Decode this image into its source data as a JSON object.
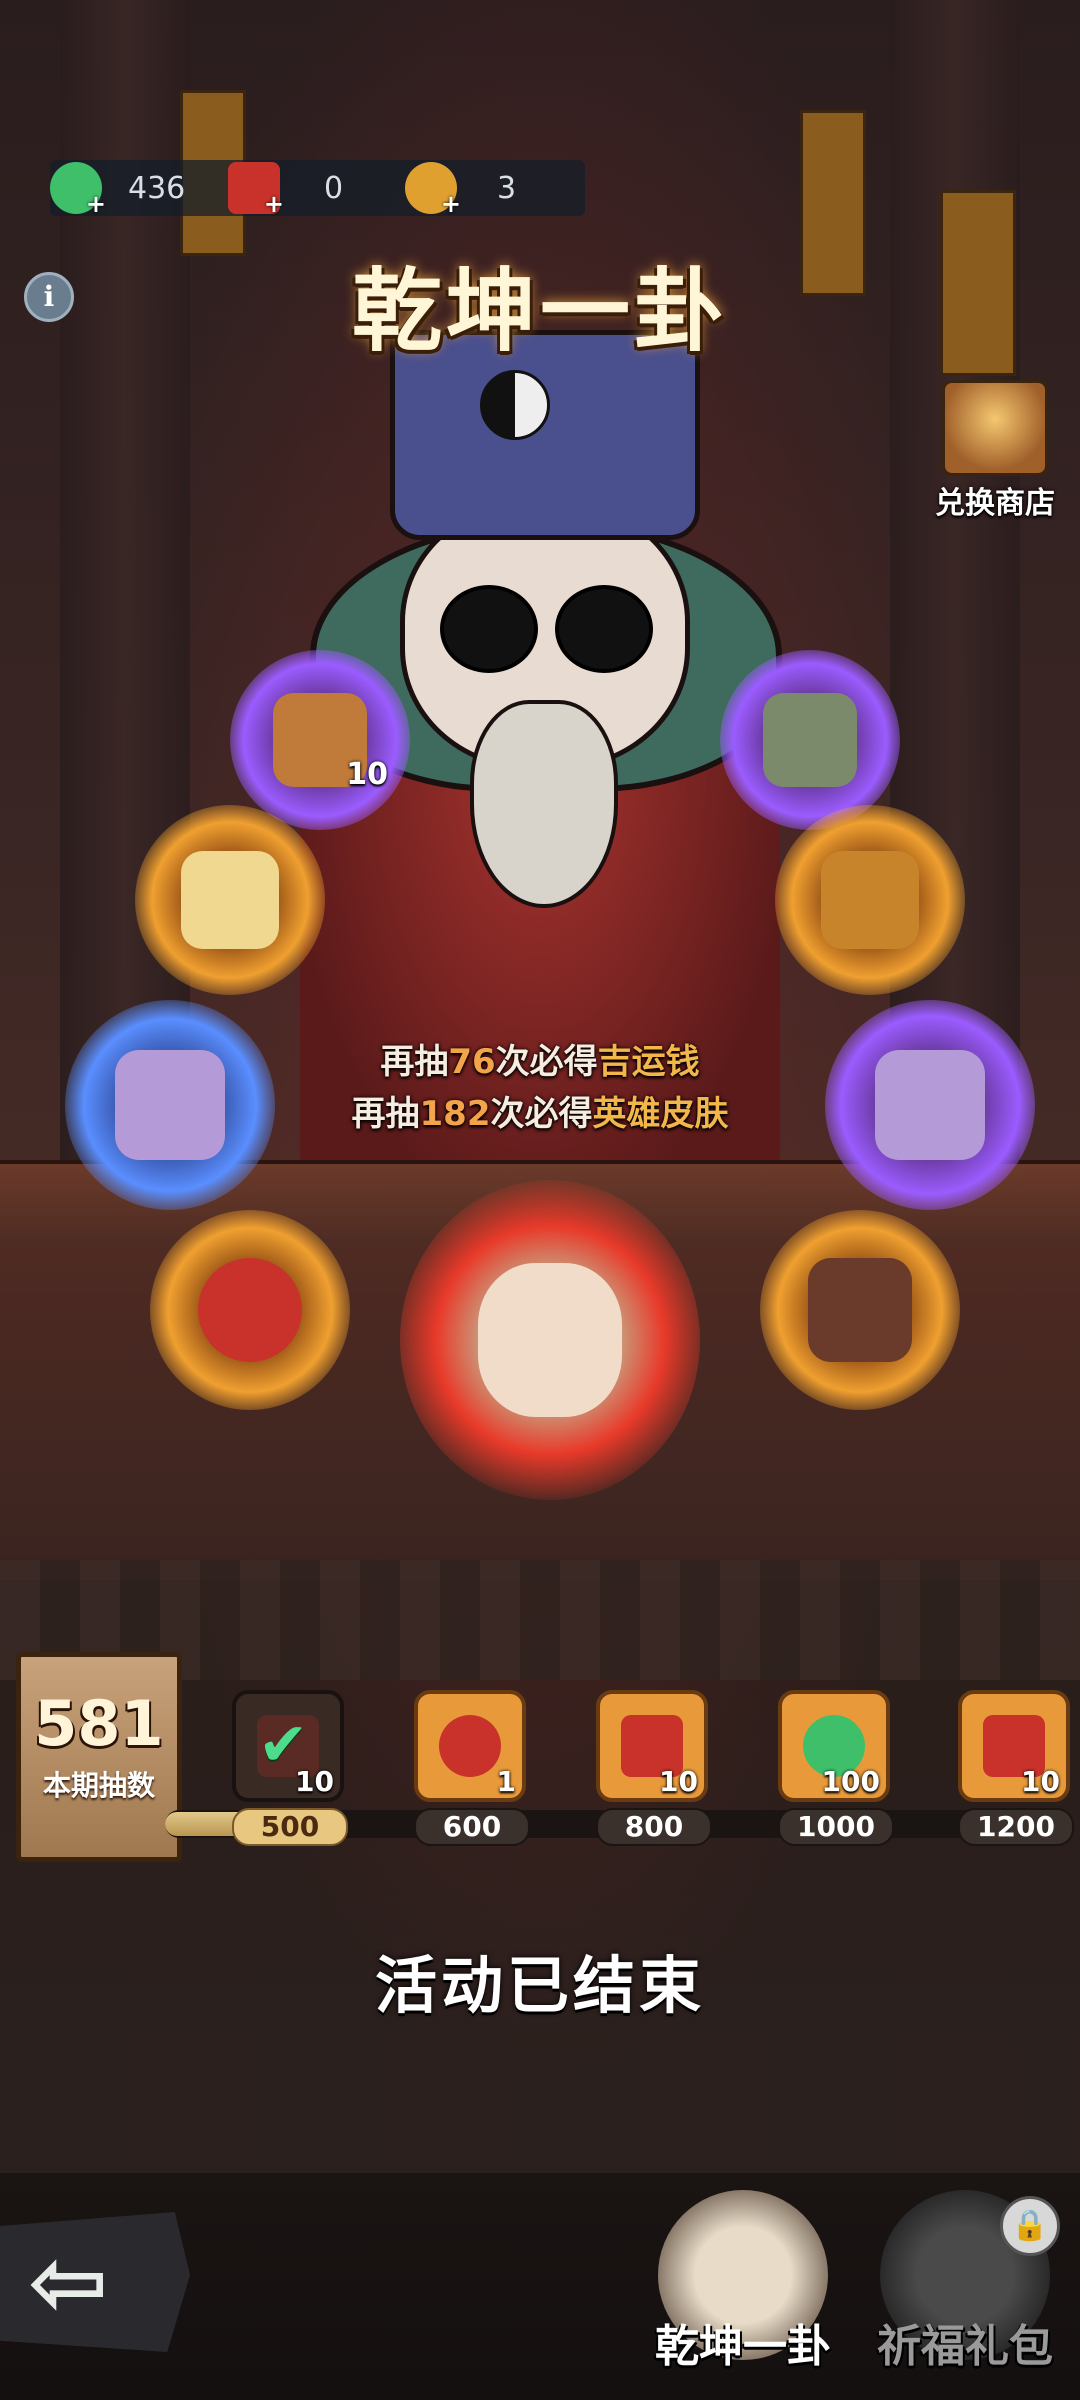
{
  "resources": [
    {
      "icon": "jade-icon",
      "value": "436",
      "color": "#3fbf6a"
    },
    {
      "icon": "red-seal-icon",
      "value": "0",
      "color": "#c8322a"
    },
    {
      "icon": "coin-charm-icon",
      "value": "3",
      "color": "#e0a030"
    }
  ],
  "title": "乾坤一卦",
  "shop_label": "兑换商店",
  "prize_orbs": [
    {
      "name": "orb-purple-chest",
      "count": "10",
      "color": "purple"
    },
    {
      "name": "orb-purple-relic",
      "count": "",
      "color": "purple"
    },
    {
      "name": "orb-gold-scroll",
      "count": "",
      "color": "gold"
    },
    {
      "name": "orb-gold-key",
      "count": "",
      "color": "gold"
    },
    {
      "name": "orb-blue-bag",
      "count": "",
      "color": "blue"
    },
    {
      "name": "orb-purple-bag",
      "count": "",
      "color": "purple"
    },
    {
      "name": "orb-gold-coin",
      "count": "",
      "color": "gold"
    },
    {
      "name": "orb-gold-bundle",
      "count": "",
      "color": "gold"
    },
    {
      "name": "orb-red-hero",
      "count": "",
      "color": "red"
    }
  ],
  "draw_info": {
    "line1_prefix": "再抽",
    "line1_num": "76",
    "line1_mid": "次必得",
    "line1_prize": "吉运钱",
    "line2_prefix": "再抽",
    "line2_num": "182",
    "line2_mid": "次必得",
    "line2_prize": "英雄皮肤"
  },
  "draw_count": {
    "value": "581",
    "label": "本期抽数"
  },
  "progress": {
    "fraction": 0.16,
    "milestones": [
      {
        "threshold": "500",
        "reward_icon": "red-seal-icon",
        "count": "10",
        "claimed": true
      },
      {
        "threshold": "600",
        "reward_icon": "coin-charm-icon",
        "count": "1",
        "claimed": false
      },
      {
        "threshold": "800",
        "reward_icon": "red-seal-icon",
        "count": "10",
        "claimed": false
      },
      {
        "threshold": "1000",
        "reward_icon": "jade-icon",
        "count": "100",
        "claimed": false
      },
      {
        "threshold": "1200",
        "reward_icon": "red-seal-icon",
        "count": "10",
        "claimed": false
      }
    ]
  },
  "status_text": "活动已结束",
  "nav": {
    "tab1": "乾坤一卦",
    "tab2": "祈福礼包"
  },
  "colors": {
    "accent": "#f3a44a",
    "title_glow": "#e09a3a",
    "claimed_check": "#4cdc8c"
  }
}
